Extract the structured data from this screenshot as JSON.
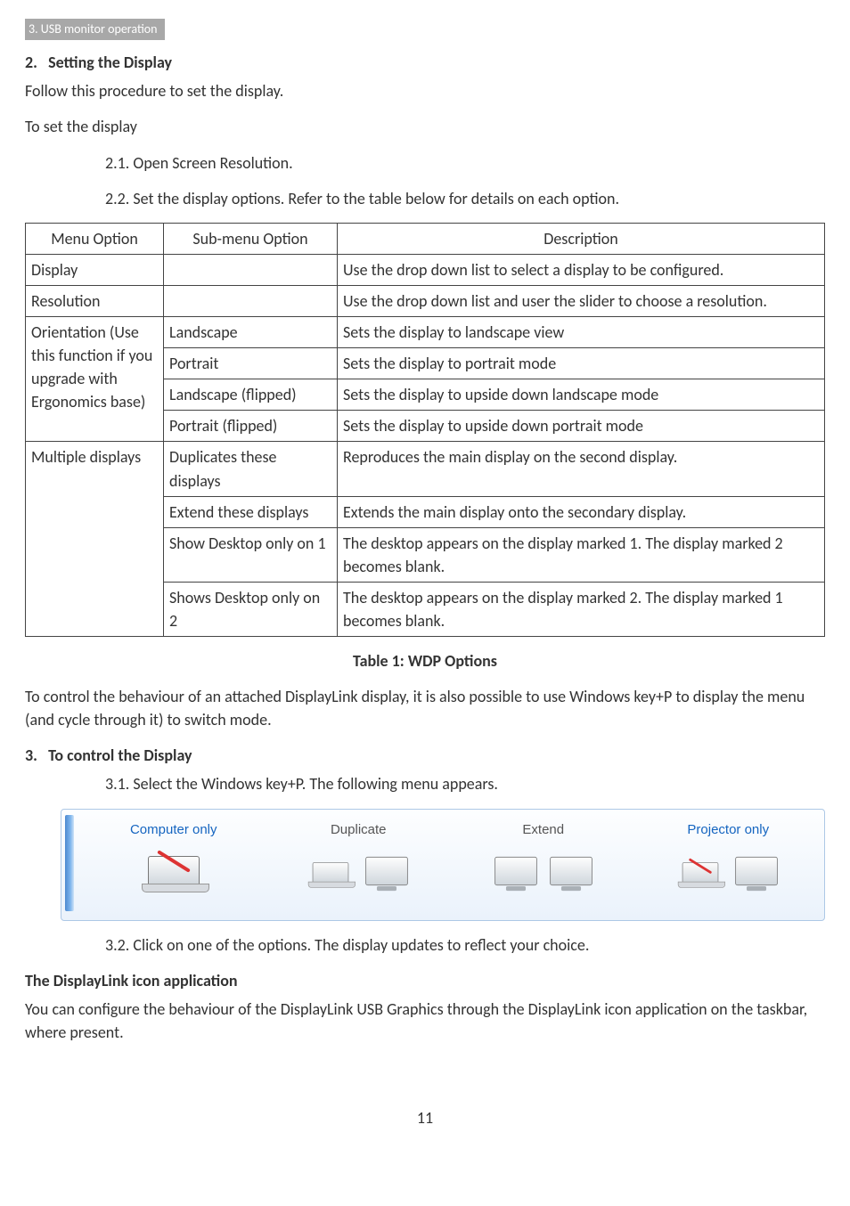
{
  "chapter_tag": "3. USB monitor operation",
  "h2_num": "2.",
  "h2_text": "Setting the Display",
  "intro1": "Follow this procedure to set the display.",
  "intro2": "To set the display",
  "step21": "2.1. Open Screen Resolution.",
  "step22": "2.2. Set the display options. Refer to the table below for details on each option.",
  "table": {
    "headers": {
      "menu": "Menu Option",
      "sub": "Sub-menu Option",
      "desc": "Description"
    },
    "rows": [
      {
        "menu": "Display",
        "sub": "",
        "desc": "Use the drop down list to select a display to be configured."
      },
      {
        "menu": "Resolution",
        "sub": "",
        "desc": "Use the drop down list and user the slider to choose a resolution."
      },
      {
        "menu": "Orientation (Use this function if you upgrade with Ergonomics base)",
        "sub": "Landscape",
        "desc": "Sets the display to landscape view"
      },
      {
        "menu": "",
        "sub": "Portrait",
        "desc": "Sets the display to portrait mode"
      },
      {
        "menu": "",
        "sub": "Landscape (flipped)",
        "desc": "Sets the display to upside down landscape mode"
      },
      {
        "menu": "",
        "sub": "Portrait (flipped)",
        "desc": "Sets the display to upside down portrait mode"
      },
      {
        "menu": "Multiple displays",
        "sub": "Duplicates these displays",
        "desc": "Reproduces the main display on the second display."
      },
      {
        "menu": "",
        "sub": "Extend these displays",
        "desc": "Extends the main display onto the secondary display."
      },
      {
        "menu": "",
        "sub": "Show Desktop only on 1",
        "desc": "The desktop appears on the display marked 1. The display marked 2 becomes blank."
      },
      {
        "menu": "",
        "sub": "Shows Desktop only on 2",
        "desc": "The desktop appears on the display marked 2. The display marked 1 becomes blank."
      }
    ]
  },
  "table_caption": "Table 1: WDP Options",
  "after_table": "To control the behaviour of an attached DisplayLink display, it is also possible to use Windows key+P to display the menu (and cycle through it) to switch mode.",
  "h3_num": "3.",
  "h3_text": "To control the Display",
  "step31": "3.1. Select the Windows key+P. The following menu appears.",
  "winp": {
    "items": [
      {
        "label": "Computer only",
        "selected": true
      },
      {
        "label": "Duplicate",
        "selected": false
      },
      {
        "label": "Extend",
        "selected": false
      },
      {
        "label": "Projector only",
        "selected": true
      }
    ]
  },
  "step32": "3.2. Click on one of the options. The display updates to reflect your choice.",
  "h4": "The DisplayLink icon application",
  "after_h4": "You can configure the behaviour of the DisplayLink USB Graphics through the DisplayLink icon application on the taskbar, where present.",
  "page_number": "11"
}
